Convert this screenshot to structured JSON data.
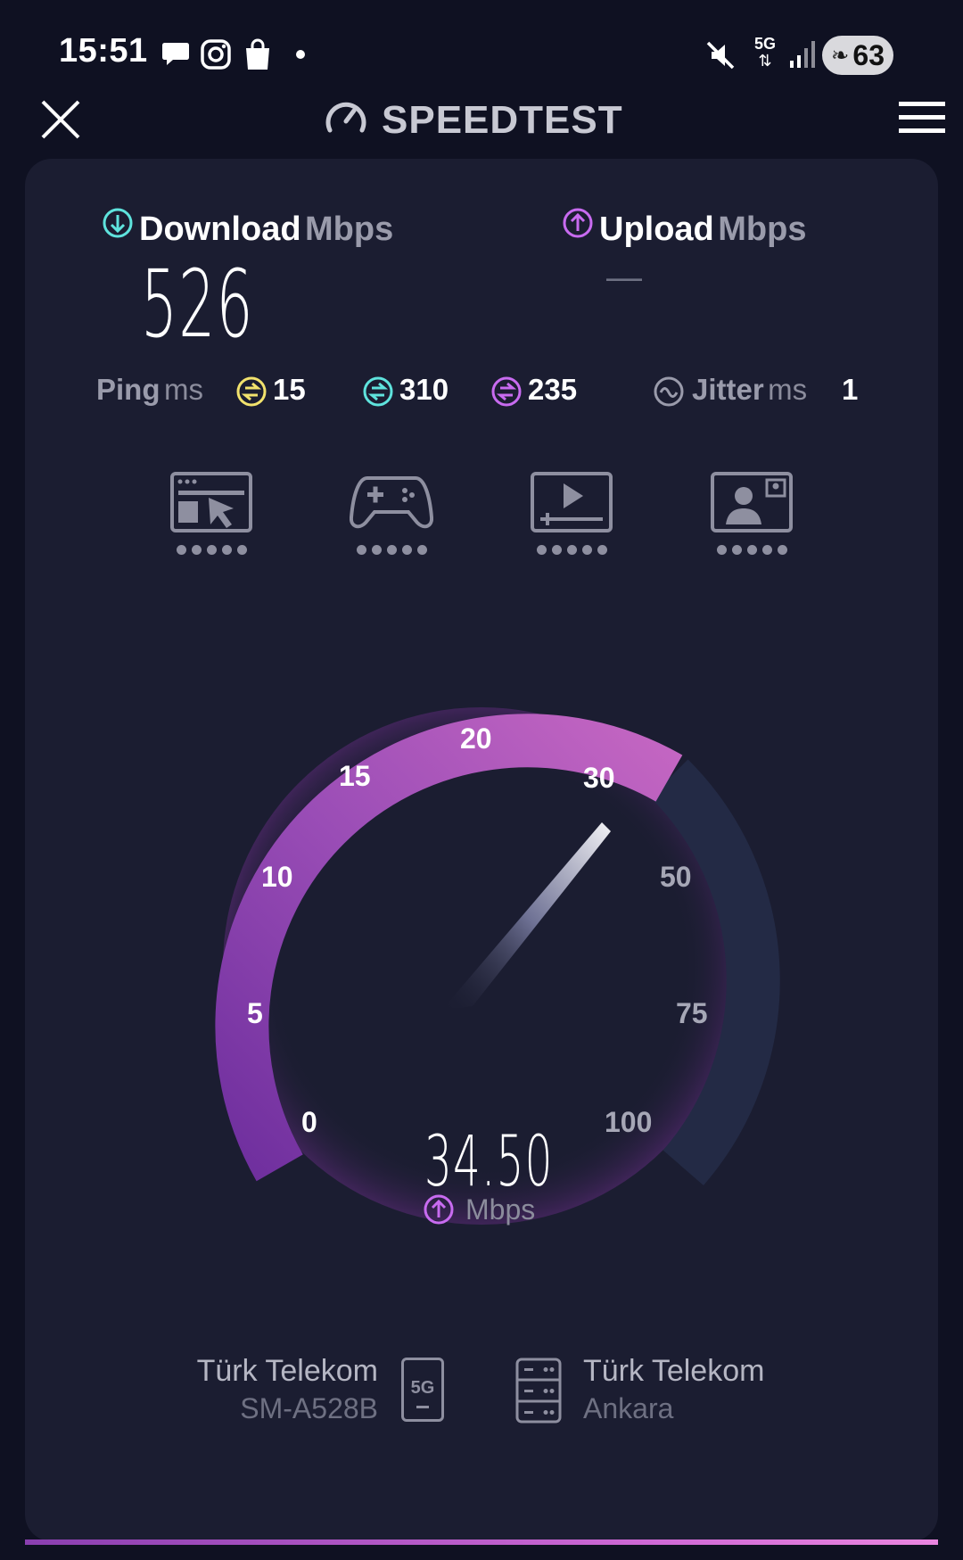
{
  "status_bar": {
    "time": "15:51",
    "battery": "63",
    "network": "5G",
    "icons": [
      "chat-bubble-icon",
      "instagram-icon",
      "shopping-bag-icon",
      "notification-dot-icon",
      "mute-icon",
      "5g-data-icon",
      "signal-bars-icon",
      "battery-icon"
    ]
  },
  "header": {
    "title": "SPEEDTEST",
    "close_icon": "close-icon",
    "menu_icon": "hamburger-menu-icon"
  },
  "download": {
    "label": "Download",
    "unit": "Mbps",
    "value": "526"
  },
  "upload": {
    "label": "Upload",
    "unit": "Mbps",
    "value": "—"
  },
  "ping": {
    "label": "Ping",
    "unit": "ms",
    "idle": "15",
    "download": "310",
    "upload": "235"
  },
  "jitter": {
    "label": "Jitter",
    "unit": "ms",
    "value": "1"
  },
  "quality_icons": [
    {
      "name": "web-browsing-icon",
      "rating": 5
    },
    {
      "name": "gaming-icon",
      "rating": 5
    },
    {
      "name": "video-streaming-icon",
      "rating": 5
    },
    {
      "name": "video-call-icon",
      "rating": 5
    }
  ],
  "gauge": {
    "ticks": [
      "0",
      "5",
      "10",
      "15",
      "20",
      "30",
      "50",
      "75",
      "100"
    ],
    "current_value": "34.50",
    "unit": "Mbps",
    "direction": "upload",
    "active_color": "#b35ec3",
    "inactive_color": "#232a45"
  },
  "provider": {
    "name": "Türk Telekom",
    "device": "SM-A528B",
    "connection_badge": "5G"
  },
  "server": {
    "name": "Türk Telekom",
    "location": "Ankara"
  },
  "colors": {
    "download_accent": "#5fe3dd",
    "upload_accent": "#c86bf0",
    "ping_idle_accent": "#f2e26d"
  }
}
